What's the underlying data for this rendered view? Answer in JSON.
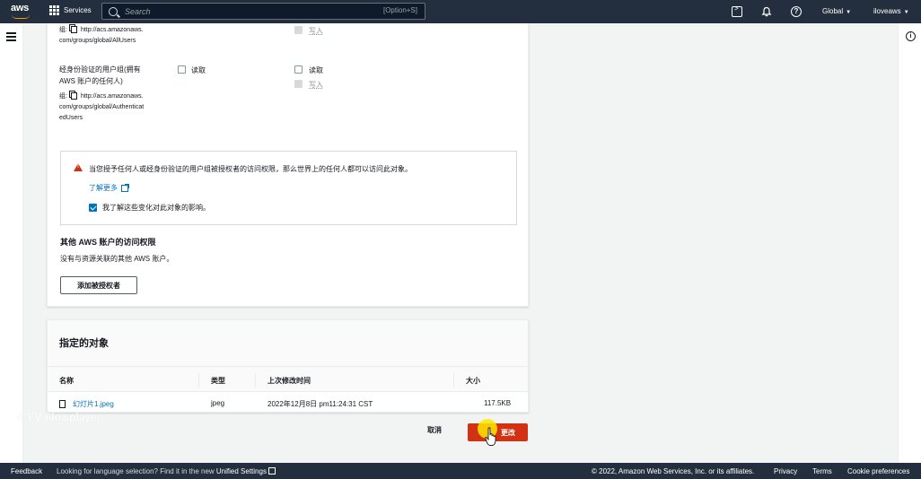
{
  "topbar": {
    "logo": "aws",
    "services_label": "Services",
    "search_placeholder": "Search",
    "search_shortcut": "[Option+S]",
    "region": "Global",
    "account": "iloveaws"
  },
  "permissions": {
    "all_users_uri_prefix": "组:",
    "all_users_uri_line1": "http://acs.amazonaws.",
    "all_users_uri_line2": "com/groups/global/AllUsers",
    "all_users_write_label": "写入",
    "auth_users_name_line1": "经身份验证的用户组(拥有",
    "auth_users_name_line2": "AWS 账户的任何人)",
    "auth_users_uri_prefix": "组:",
    "auth_users_uri_line1": "http://acs.amazonaws.",
    "auth_users_uri_line2": "com/groups/global/Authenticat",
    "auth_users_uri_line3": "edUsers",
    "objects_read_label": "读取",
    "acl_read_label": "读取",
    "acl_write_label": "写入"
  },
  "alert": {
    "message": "当您授予任何人或经身份验证的用户组被授权者的访问权限，那么世界上的任何人都可以访问此对象。",
    "learn_more": "了解更多",
    "acknowledge": "我了解这些变化对此对象的影响。",
    "acknowledged": true
  },
  "other_accounts": {
    "title": "其他 AWS 账户的访问权限",
    "description": "没有与资源关联的其他 AWS 账户。",
    "add_button": "添加被授权者"
  },
  "objects": {
    "title": "指定的对象",
    "columns": [
      "名称",
      "类型",
      "上次修改时间",
      "大小"
    ],
    "rows": [
      {
        "name": "幻灯片1.jpeg",
        "type": "jpeg",
        "modified": "2022年12月8日 pm11:24:31 CST",
        "size": "117.5KB"
      }
    ]
  },
  "actions": {
    "cancel": "取消",
    "save": "更改"
  },
  "watermark": "© FV Flowplayer",
  "footer": {
    "feedback": "Feedback",
    "language_notice": "Looking for language selection? Find it in the new",
    "unified_settings": "Unified Settings",
    "copyright": "© 2022, Amazon Web Services, Inc. or its affiliates.",
    "privacy": "Privacy",
    "terms": "Terms",
    "cookies": "Cookie preferences"
  },
  "colors": {
    "nav_bg": "#232f3e",
    "link": "#0073bb",
    "danger": "#d13212",
    "accent": "#ff9900"
  }
}
